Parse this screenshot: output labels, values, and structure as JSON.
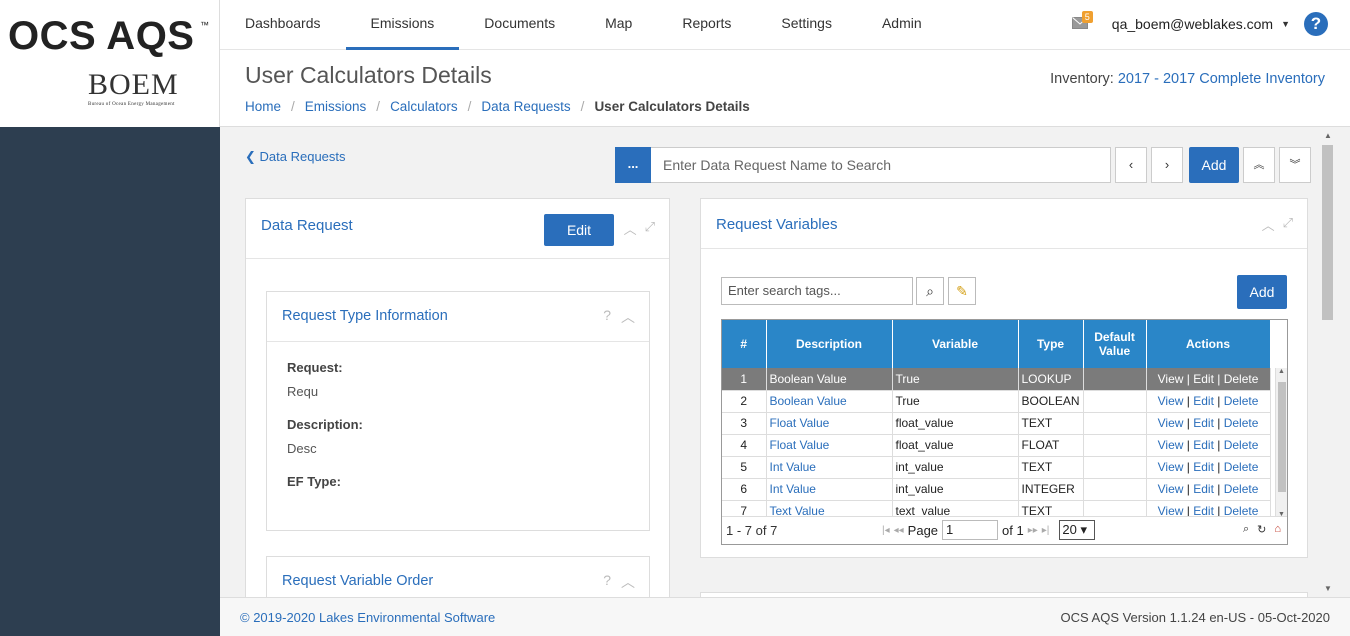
{
  "brand": {
    "name": "OCS AQS",
    "tm": "™",
    "agency": "BOEM",
    "agency_full": "Bureau of Ocean Energy Management"
  },
  "nav": {
    "items": [
      "Dashboards",
      "Emissions",
      "Documents",
      "Map",
      "Reports",
      "Settings",
      "Admin"
    ],
    "active": "Emissions"
  },
  "user": {
    "mail_count": "5",
    "email": "qa_boem@weblakes.com",
    "help": "?"
  },
  "header": {
    "title": "User Calculators Details",
    "breadcrumb": [
      "Home",
      "Emissions",
      "Calculators",
      "Data Requests",
      "User Calculators Details"
    ],
    "inventory_label": "Inventory:",
    "inventory_value": "2017 - 2017 Complete Inventory"
  },
  "toolbar": {
    "back_label": "Data Requests",
    "dots_label": "...",
    "search_placeholder": "Enter Data Request Name to Search",
    "prev": "‹",
    "next": "›",
    "add_label": "Add",
    "expand_all": "⌃⌃",
    "collapse_all": "⌄⌄"
  },
  "data_request_panel": {
    "title": "Data Request",
    "edit_label": "Edit",
    "type_info": {
      "title": "Request Type Information",
      "help": "?",
      "fields": [
        {
          "label": "Request:",
          "value": "Requ"
        },
        {
          "label": "Description:",
          "value": "Desc"
        },
        {
          "label": "EF Type:",
          "value": ""
        }
      ]
    },
    "variable_order": {
      "title": "Request Variable Order",
      "help": "?"
    }
  },
  "request_variables": {
    "title": "Request Variables",
    "search_placeholder": "Enter search tags...",
    "add_label": "Add",
    "columns": [
      "#",
      "Description",
      "Variable",
      "Type",
      "Default Value",
      "Actions"
    ],
    "rows": [
      {
        "num": "1",
        "description": "Boolean Value",
        "variable": "True",
        "type": "LOOKUP",
        "default": "",
        "selected": true
      },
      {
        "num": "2",
        "description": "Boolean Value",
        "variable": "True",
        "type": "BOOLEAN",
        "default": ""
      },
      {
        "num": "3",
        "description": "Float Value",
        "variable": "float_value",
        "type": "TEXT",
        "default": ""
      },
      {
        "num": "4",
        "description": "Float Value",
        "variable": "float_value",
        "type": "FLOAT",
        "default": ""
      },
      {
        "num": "5",
        "description": "Int Value",
        "variable": "int_value",
        "type": "TEXT",
        "default": ""
      },
      {
        "num": "6",
        "description": "Int Value",
        "variable": "int_value",
        "type": "INTEGER",
        "default": ""
      },
      {
        "num": "7",
        "description": "Text Value",
        "variable": "text_value",
        "type": "TEXT",
        "default": ""
      }
    ],
    "actions": [
      "View",
      "Edit",
      "Delete"
    ],
    "footer": {
      "count": "1 - 7 of 7",
      "page_label": "Page",
      "page": "1",
      "of_label": "of 1",
      "page_size": "20"
    }
  },
  "footer": {
    "copyright": "© 2019-2020 Lakes Environmental Software",
    "version": "OCS AQS Version 1.1.24 en-US - 05-Oct-2020"
  },
  "colors": {
    "primary": "#2a6ebb",
    "sidebar": "#2d3e50",
    "grid_header": "#2a86c8",
    "selected_row": "#7b7b7b",
    "badge": "#f0a030"
  }
}
